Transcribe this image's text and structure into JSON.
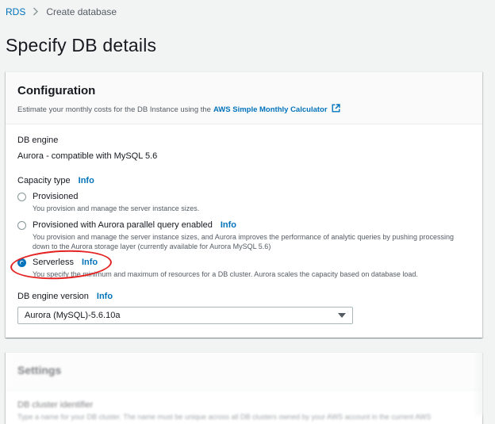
{
  "breadcrumb": {
    "root": "RDS",
    "current": "Create database"
  },
  "page": {
    "title": "Specify DB details"
  },
  "configuration": {
    "title": "Configuration",
    "description": "Estimate your monthly costs for the DB Instance using the",
    "calculator_link": "AWS Simple Monthly Calculator",
    "db_engine_label": "DB engine",
    "db_engine_value": "Aurora - compatible with MySQL 5.6",
    "capacity_type_label": "Capacity type",
    "info_label": "Info",
    "options": [
      {
        "label": "Provisioned",
        "description": "You provision and manage the server instance sizes.",
        "selected": false
      },
      {
        "label": "Provisioned with Aurora parallel query enabled",
        "description": "You provision and manage the server instance sizes, and Aurora improves the performance of analytic queries by pushing processing down to the Aurora storage layer (currently available for Aurora MySQL 5.6)",
        "selected": false
      },
      {
        "label": "Serverless",
        "description": "You specify the minimum and maximum of resources for a DB cluster. Aurora scales the capacity based on database load.",
        "selected": true
      }
    ],
    "engine_version_label": "DB engine version",
    "engine_version_value": "Aurora (MySQL)-5.6.10a"
  },
  "settings": {
    "title": "Settings",
    "cluster_identifier_label": "DB cluster identifier",
    "cluster_identifier_desc": "Type a name for your DB cluster. The name must be unique across all DB clusters owned by your AWS account in the current AWS"
  },
  "colors": {
    "link": "#0073bb",
    "annotation": "#e52222",
    "background": "#f2f3f3"
  }
}
